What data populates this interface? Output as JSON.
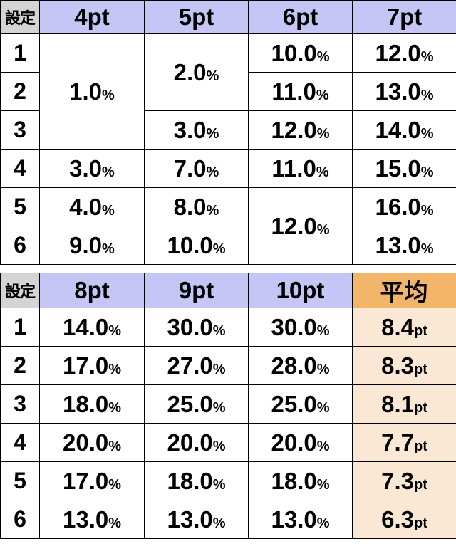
{
  "tables": [
    {
      "name": "pt-distribution-low",
      "headers": {
        "setting": "設定",
        "columns": [
          "4pt",
          "5pt",
          "6pt",
          "7pt"
        ]
      },
      "row_labels": [
        "1",
        "2",
        "3",
        "4",
        "5",
        "6"
      ],
      "unit": "%",
      "cells": [
        {
          "col": 0,
          "row": 0,
          "rowspan": 3,
          "value": "1.0"
        },
        {
          "col": 0,
          "row": 3,
          "rowspan": 1,
          "value": "3.0"
        },
        {
          "col": 0,
          "row": 4,
          "rowspan": 1,
          "value": "4.0"
        },
        {
          "col": 0,
          "row": 5,
          "rowspan": 1,
          "value": "9.0"
        },
        {
          "col": 1,
          "row": 0,
          "rowspan": 2,
          "value": "2.0"
        },
        {
          "col": 1,
          "row": 2,
          "rowspan": 1,
          "value": "3.0"
        },
        {
          "col": 1,
          "row": 3,
          "rowspan": 1,
          "value": "7.0"
        },
        {
          "col": 1,
          "row": 4,
          "rowspan": 1,
          "value": "8.0"
        },
        {
          "col": 1,
          "row": 5,
          "rowspan": 1,
          "value": "10.0"
        },
        {
          "col": 2,
          "row": 0,
          "rowspan": 1,
          "value": "10.0"
        },
        {
          "col": 2,
          "row": 1,
          "rowspan": 1,
          "value": "11.0"
        },
        {
          "col": 2,
          "row": 2,
          "rowspan": 1,
          "value": "12.0"
        },
        {
          "col": 2,
          "row": 3,
          "rowspan": 1,
          "value": "11.0"
        },
        {
          "col": 2,
          "row": 4,
          "rowspan": 2,
          "value": "12.0"
        },
        {
          "col": 3,
          "row": 0,
          "rowspan": 1,
          "value": "12.0"
        },
        {
          "col": 3,
          "row": 1,
          "rowspan": 1,
          "value": "13.0"
        },
        {
          "col": 3,
          "row": 2,
          "rowspan": 1,
          "value": "14.0"
        },
        {
          "col": 3,
          "row": 3,
          "rowspan": 1,
          "value": "15.0"
        },
        {
          "col": 3,
          "row": 4,
          "rowspan": 1,
          "value": "16.0"
        },
        {
          "col": 3,
          "row": 5,
          "rowspan": 1,
          "value": "13.0"
        }
      ]
    },
    {
      "name": "pt-distribution-high",
      "headers": {
        "setting": "設定",
        "columns": [
          "8pt",
          "9pt",
          "10pt"
        ],
        "average": "平均"
      },
      "row_labels": [
        "1",
        "2",
        "3",
        "4",
        "5",
        "6"
      ],
      "unit": "%",
      "average_unit": "pt",
      "rows": [
        {
          "label": "1",
          "values": [
            "14.0",
            "30.0",
            "30.0"
          ],
          "average": "8.4"
        },
        {
          "label": "2",
          "values": [
            "17.0",
            "27.0",
            "28.0"
          ],
          "average": "8.3"
        },
        {
          "label": "3",
          "values": [
            "18.0",
            "25.0",
            "25.0"
          ],
          "average": "8.1"
        },
        {
          "label": "4",
          "values": [
            "20.0",
            "20.0",
            "20.0"
          ],
          "average": "7.7"
        },
        {
          "label": "5",
          "values": [
            "17.0",
            "18.0",
            "18.0"
          ],
          "average": "7.3"
        },
        {
          "label": "6",
          "values": [
            "13.0",
            "13.0",
            "13.0"
          ],
          "average": "6.3"
        }
      ]
    }
  ],
  "colors": {
    "header_blue": "#c5c6f5",
    "header_gray": "#d4d4d4",
    "header_orange": "#f2b56a",
    "cell_orange": "#fae8d5",
    "border": "#000000"
  }
}
